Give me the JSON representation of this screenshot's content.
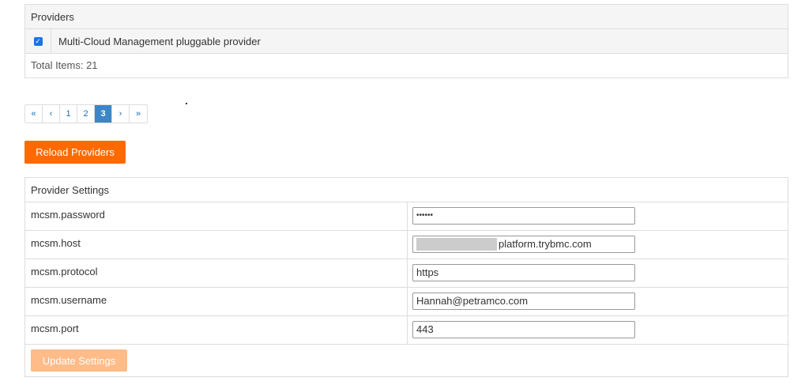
{
  "providers": {
    "heading": "Providers",
    "items": [
      {
        "name": "Multi-Cloud Management pluggable provider",
        "checked": true
      }
    ],
    "total_label": "Total Items: 21"
  },
  "pagination": {
    "first": "«",
    "prev": "‹",
    "pages": [
      "1",
      "2",
      "3"
    ],
    "current_page": "3",
    "next": "›",
    "last": "»"
  },
  "reload_button": "Reload Providers",
  "settings": {
    "heading": "Provider Settings",
    "rows": [
      {
        "label": "mcsm.password",
        "value": "••••••",
        "type": "password"
      },
      {
        "label": "mcsm.host",
        "value": "platform.trybmc.com",
        "type": "redacted-host"
      },
      {
        "label": "mcsm.protocol",
        "value": "https",
        "type": "text"
      },
      {
        "label": "mcsm.username",
        "value": "Hannah@petramco.com",
        "type": "text"
      },
      {
        "label": "mcsm.port",
        "value": "443",
        "type": "text"
      }
    ],
    "update_button": "Update Settings"
  },
  "colors": {
    "accent_orange": "#ff6a00",
    "disabled_orange": "#ffbb88",
    "active_page": "#3a86c8",
    "checkbox_blue": "#1a73e8"
  }
}
